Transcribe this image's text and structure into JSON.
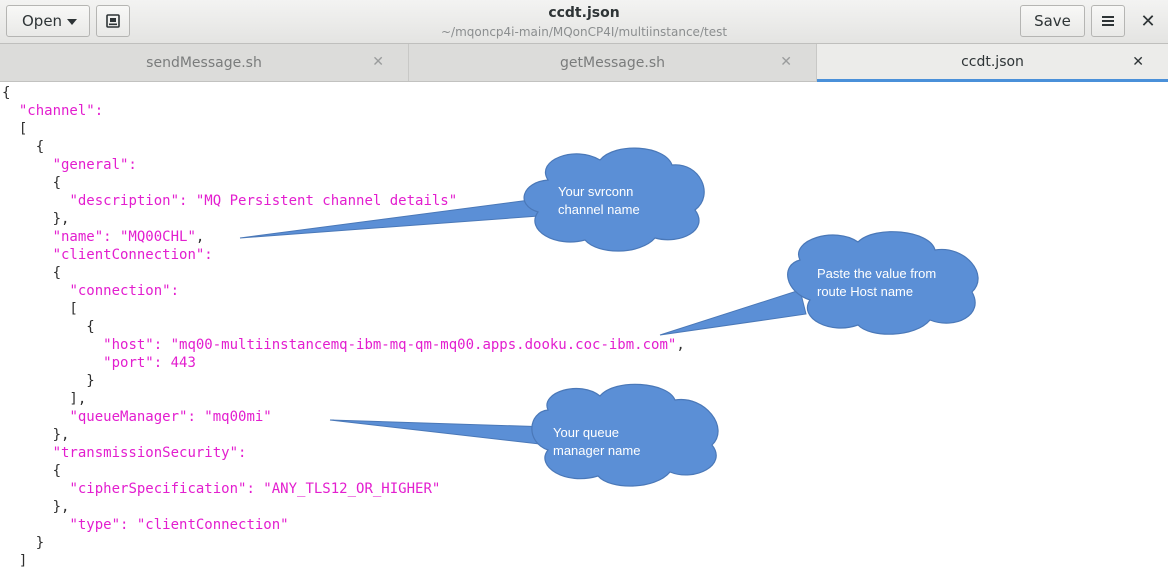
{
  "header": {
    "open_label": "Open",
    "title": "ccdt.json",
    "subtitle": "~/mqoncp4i-main/MQonCP4I/multiinstance/test",
    "save_label": "Save",
    "close_glyph": "✕"
  },
  "icons": {
    "caret": "chevron-down-icon",
    "recent": "recent-documents-icon",
    "menu": "hamburger-menu-icon",
    "close": "close-icon"
  },
  "tabs": [
    {
      "label": "sendMessage.sh",
      "close": "✕",
      "active": false
    },
    {
      "label": "getMessage.sh",
      "close": "✕",
      "active": false
    },
    {
      "label": "ccdt.json",
      "close": "✕",
      "active": true
    }
  ],
  "code_lines": [
    [
      "{"
    ],
    [
      "  ",
      "\"channel\":"
    ],
    [
      "  ["
    ],
    [
      "    {"
    ],
    [
      "      ",
      "\"general\":"
    ],
    [
      "      {"
    ],
    [
      "        ",
      "\"description\": \"MQ Persistent channel details\""
    ],
    [
      "      },"
    ],
    [
      "      ",
      "\"name\": \"MQ00CHL\"",
      ","
    ],
    [
      "      ",
      "\"clientConnection\":"
    ],
    [
      "      {"
    ],
    [
      "        ",
      "\"connection\":"
    ],
    [
      "        ["
    ],
    [
      "          {"
    ],
    [
      "            ",
      "\"host\": \"mq00-multiinstancemq-ibm-mq-qm-mq00.apps.dooku.coc-ibm.com\"",
      ","
    ],
    [
      "            ",
      "\"port\": 443"
    ],
    [
      "          }"
    ],
    [
      "        ],"
    ],
    [
      "        ",
      "\"queueManager\": \"mq00mi\""
    ],
    [
      "      },"
    ],
    [
      "      ",
      "\"transmissionSecurity\":"
    ],
    [
      "      {"
    ],
    [
      "        ",
      "\"cipherSpecification\": \"ANY_TLS12_OR_HIGHER\""
    ],
    [
      "      },"
    ],
    [
      "        ",
      "\"type\": \"clientConnection\""
    ],
    [
      "    }"
    ],
    [
      "  ]"
    ]
  ],
  "callouts": [
    {
      "line1": "Your svrconn",
      "line2": "channel name"
    },
    {
      "line1": "Paste the value from",
      "line2": "route Host name"
    },
    {
      "line1": "Your queue",
      "line2": "manager name"
    }
  ],
  "colors": {
    "json_string": "#e31ecf",
    "callout_fill": "#5b8fd6",
    "tab_accent": "#4a90d9"
  }
}
